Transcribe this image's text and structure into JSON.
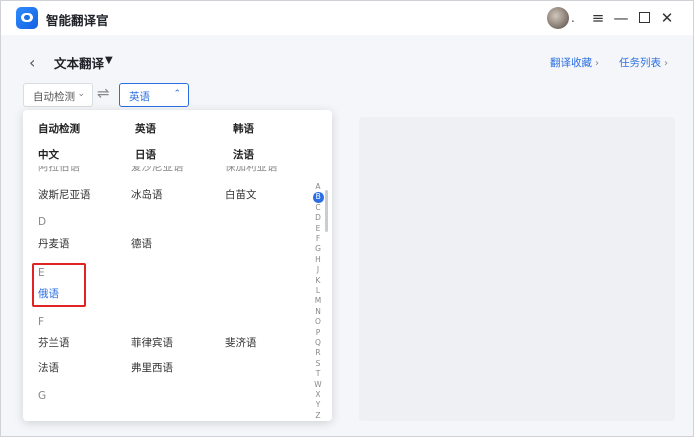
{
  "window": {
    "app_title": "智能翻译官",
    "menu_dot": ".",
    "menu_icon": "≡",
    "min_icon": "—",
    "close_icon": "✕"
  },
  "header": {
    "back_icon": "‹",
    "page_title": "文本翻译",
    "title_caret": "▼",
    "link_favorites": "翻译收藏",
    "link_tasks": "任务列表",
    "link_chevron": "›"
  },
  "selectors": {
    "source_lang": "自动检测",
    "target_lang": "英语",
    "source_chevron": "⌄",
    "target_chevron": "⌃",
    "swap_icon": "⇌"
  },
  "dropdown": {
    "common": [
      [
        "自动检测",
        "英语",
        "韩语"
      ],
      [
        "中文",
        "日语",
        "法语"
      ]
    ],
    "cutoff_row": [
      "阿拉伯语",
      "爱沙尼亚语",
      "保加利亚语"
    ],
    "row_b": [
      "波斯尼亚语",
      "冰岛语",
      "白苗文"
    ],
    "letter_d": "D",
    "row_d": [
      "丹麦语",
      "德语"
    ],
    "letter_e": "E",
    "row_e": [
      "俄语"
    ],
    "letter_f": "F",
    "row_f1": [
      "芬兰语",
      "菲律宾语",
      "斐济语"
    ],
    "row_f2": [
      "法语",
      "弗里西语"
    ],
    "letter_g": "G",
    "alphabet": [
      "A",
      "B",
      "C",
      "D",
      "E",
      "F",
      "G",
      "H",
      "J",
      "K",
      "L",
      "M",
      "N",
      "O",
      "P",
      "Q",
      "R",
      "S",
      "T",
      "W",
      "X",
      "Y",
      "Z"
    ],
    "active_letter": "B"
  }
}
